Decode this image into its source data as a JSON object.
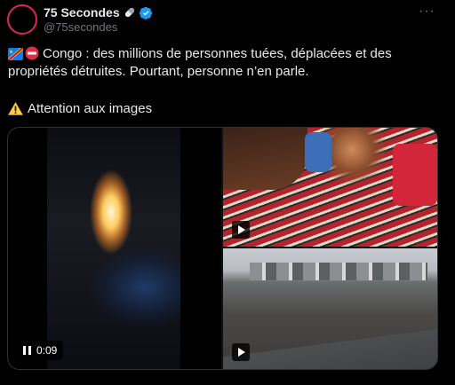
{
  "author": {
    "name": "75 Secondes",
    "handle": "@75secondes",
    "name_emoji_icon": "pill-emoji-icon",
    "verified_icon": "verified-badge-icon",
    "verified_color": "#1d9bf0"
  },
  "more_label": "···",
  "tweet": {
    "line1": "Congo : des millions de personnes tuées, déplacées et des",
    "line2": "propriétés détruites. Pourtant, personne n’en parle.",
    "line3": "Attention aux images",
    "line1_icons": [
      "drc-flag-emoji-icon",
      "no-entry-emoji-icon"
    ],
    "line3_icon": "warning-emoji-icon"
  },
  "media": {
    "main_video_time": "0:09",
    "main_video_control_icon": "pause-icon",
    "thumb_icons": [
      "play-icon",
      "play-icon"
    ]
  },
  "colors": {
    "background": "#000000",
    "text": "#e7e9ea",
    "secondary": "#71767b",
    "border": "#2f3336"
  }
}
